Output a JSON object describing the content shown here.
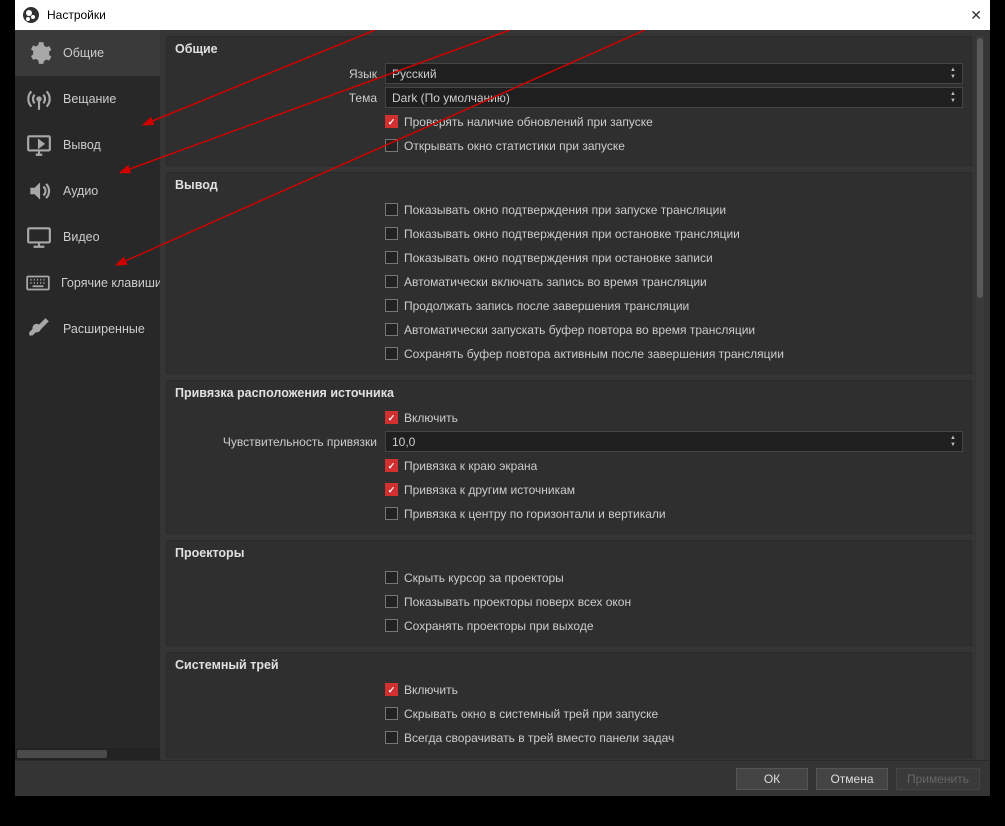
{
  "window": {
    "title": "Настройки"
  },
  "sidebar": {
    "items": [
      {
        "label": "Общие"
      },
      {
        "label": "Вещание"
      },
      {
        "label": "Вывод"
      },
      {
        "label": "Аудио"
      },
      {
        "label": "Видео"
      },
      {
        "label": "Горячие клавиши"
      },
      {
        "label": "Расширенные"
      }
    ]
  },
  "groups": {
    "general": {
      "title": "Общие",
      "language_label": "Язык",
      "language_value": "Русский",
      "theme_label": "Тема",
      "theme_value": "Dark (По умолчанию)",
      "check_updates": "Проверять наличие обновлений при запуске",
      "open_stats": "Открывать окно статистики при запуске"
    },
    "output": {
      "title": "Вывод",
      "c1": "Показывать окно подтверждения при запуске трансляции",
      "c2": "Показывать окно подтверждения при остановке трансляции",
      "c3": "Показывать окно подтверждения при остановке записи",
      "c4": "Автоматически включать запись во время трансляции",
      "c5": "Продолжать запись после завершения трансляции",
      "c6": "Автоматически запускать буфер повтора во время трансляции",
      "c7": "Сохранять буфер повтора активным после завершения трансляции"
    },
    "snap": {
      "title": "Привязка расположения источника",
      "enable": "Включить",
      "sens_label": "Чувствительность привязки",
      "sens_value": "10,0",
      "edge": "Привязка к краю экрана",
      "others": "Привязка к другим источникам",
      "center": "Привязка к центру по горизонтали и вертикали"
    },
    "proj": {
      "title": "Проекторы",
      "c1": "Скрыть курсор за проекторы",
      "c2": "Показывать проекторы поверх всех окон",
      "c3": "Сохранять проекторы при выходе"
    },
    "tray": {
      "title": "Системный трей",
      "enable": "Включить",
      "c1": "Скрывать окно в системный трей при запуске",
      "c2": "Всегда сворачивать в трей вместо панели задач"
    }
  },
  "footer": {
    "ok": "ОК",
    "cancel": "Отмена",
    "apply": "Применить"
  }
}
